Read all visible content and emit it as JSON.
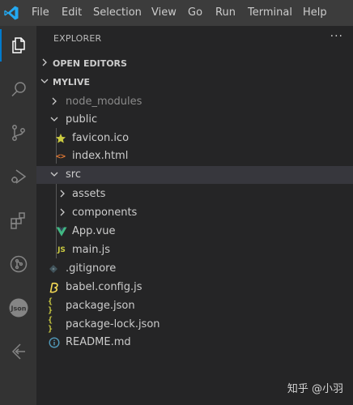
{
  "menu": [
    "File",
    "Edit",
    "Selection",
    "View",
    "Go",
    "Run",
    "Terminal",
    "Help"
  ],
  "explorer": {
    "title": "EXPLORER",
    "more": "···",
    "open_editors": "OPEN EDITORS",
    "project": "MYLIVE"
  },
  "tree": [
    {
      "label": "node_modules",
      "type": "folder",
      "expanded": false
    },
    {
      "label": "public",
      "type": "folder",
      "expanded": true
    },
    {
      "label": "favicon.ico",
      "type": "file",
      "icon": "star-icon"
    },
    {
      "label": "index.html",
      "type": "file",
      "icon": "html-icon"
    },
    {
      "label": "src",
      "type": "folder",
      "expanded": true
    },
    {
      "label": "assets",
      "type": "folder",
      "expanded": false
    },
    {
      "label": "components",
      "type": "folder",
      "expanded": false
    },
    {
      "label": "App.vue",
      "type": "file",
      "icon": "vue-icon"
    },
    {
      "label": "main.js",
      "type": "file",
      "icon": "js-icon"
    },
    {
      "label": ".gitignore",
      "type": "file",
      "icon": "git-icon"
    },
    {
      "label": "babel.config.js",
      "type": "file",
      "icon": "babel-icon"
    },
    {
      "label": "package.json",
      "type": "file",
      "icon": "json-icon"
    },
    {
      "label": "package-lock.json",
      "type": "file",
      "icon": "json-icon"
    },
    {
      "label": "README.md",
      "type": "file",
      "icon": "info-icon"
    }
  ],
  "icon_glyphs": {
    "js": "JS",
    "json": "{ }",
    "html": "<>",
    "json_ext": "Json"
  },
  "watermark": "知乎 @小羽",
  "colors": {
    "accent": "#007acc",
    "vue": "#41b883",
    "js": "#cbcb41",
    "html": "#e37933",
    "star": "#cbcb41",
    "info": "#519aba"
  }
}
